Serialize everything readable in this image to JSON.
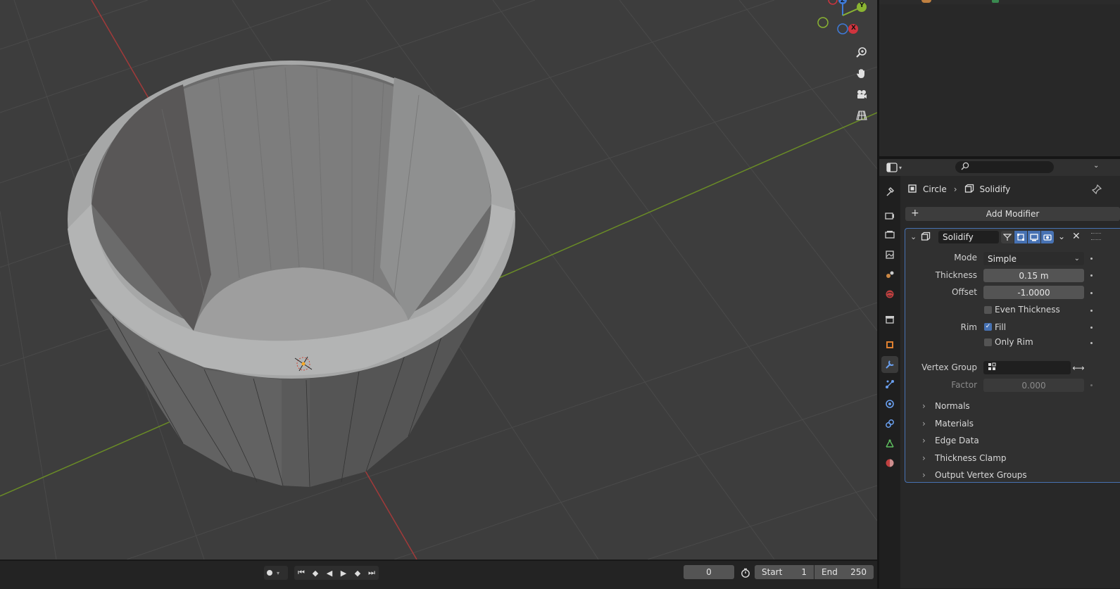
{
  "timeline": {
    "current_frame": "0",
    "start_label": "Start",
    "start_value": "1",
    "end_label": "End",
    "end_value": "250"
  },
  "properties": {
    "breadcrumb": {
      "object": "Circle",
      "modifier": "Solidify"
    },
    "add_modifier_label": "Add Modifier",
    "modifier": {
      "name": "Solidify",
      "mode_label": "Mode",
      "mode_value": "Simple",
      "thickness_label": "Thickness",
      "thickness_value": "0.15 m",
      "offset_label": "Offset",
      "offset_value": "-1.0000",
      "even_thickness_label": "Even Thickness",
      "even_thickness_checked": false,
      "rim_label": "Rim",
      "fill_label": "Fill",
      "fill_checked": true,
      "only_rim_label": "Only Rim",
      "only_rim_checked": false,
      "vertex_group_label": "Vertex Group",
      "factor_label": "Factor",
      "factor_value": "0.000",
      "subpanels": [
        "Normals",
        "Materials",
        "Edge Data",
        "Thickness Clamp",
        "Output Vertex Groups"
      ]
    }
  },
  "gizmo": {
    "z_label": "Z",
    "y_label": "Y",
    "x_label": "X"
  },
  "colors": {
    "accent_blue": "#4772b3",
    "x_axis": "#a23a3a",
    "y_axis": "#6a8c26",
    "active_tab": "#3a3a3a"
  }
}
